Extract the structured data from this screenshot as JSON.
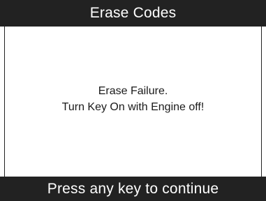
{
  "header": {
    "title": "Erase Codes"
  },
  "message": {
    "line1": "Erase Failure.",
    "line2": "Turn Key On with Engine off!"
  },
  "footer": {
    "prompt": "Press any key to continue"
  },
  "colors": {
    "bar_background": "#222222",
    "bar_text": "#ffffff",
    "content_background": "#ffffff",
    "message_text": "#1a1a1a"
  }
}
